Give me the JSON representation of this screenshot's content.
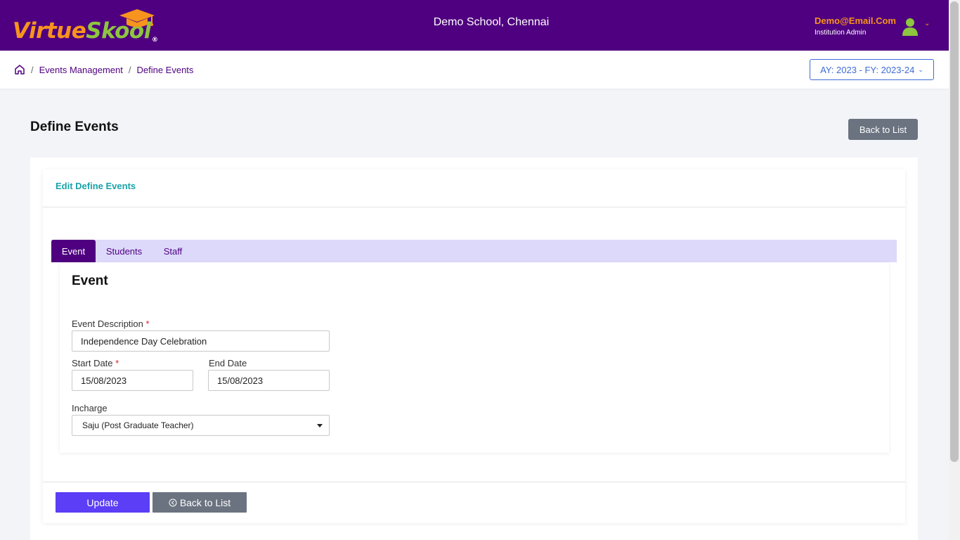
{
  "header": {
    "logo_part1": "Virtue",
    "logo_part2": "Skool",
    "logo_reg": "®",
    "school_name": "Demo School, Chennai",
    "user_email": "Demo@Email.Com",
    "user_role": "Institution Admin",
    "icons": [
      "graduation-cap-icon",
      "user-avatar-icon",
      "chevron-down-icon"
    ]
  },
  "breadcrumb": {
    "items": [
      "Events Management",
      "Define Events"
    ],
    "separator": "/",
    "home_icon": "home-icon"
  },
  "academic_year": {
    "label": "AY: 2023 - FY: 2023-24"
  },
  "page": {
    "title": "Define Events",
    "back_to_list_label": "Back to List"
  },
  "card": {
    "heading": "Edit Define Events"
  },
  "tabs": [
    {
      "label": "Event",
      "active": true
    },
    {
      "label": "Students",
      "active": false
    },
    {
      "label": "Staff",
      "active": false
    }
  ],
  "form": {
    "section_title": "Event",
    "required_mark": "*",
    "event_description": {
      "label": "Event Description",
      "value": "Independence Day Celebration"
    },
    "start_date": {
      "label": "Start Date",
      "value": "15/08/2023"
    },
    "end_date": {
      "label": "End Date",
      "value": "15/08/2023"
    },
    "incharge": {
      "label": "Incharge",
      "value": "Saju (Post Graduate Teacher)"
    }
  },
  "footer_buttons": {
    "update_label": "Update",
    "back_label": "Back to List"
  },
  "colors": {
    "header_bg": "#4f0080",
    "accent_orange": "#f7941d",
    "accent_green": "#8dc63f",
    "tab_bar_bg": "#ddd9fb",
    "primary_button": "#5b3ef5",
    "secondary_button": "#6b7380",
    "card_heading": "#1aa3a8"
  }
}
